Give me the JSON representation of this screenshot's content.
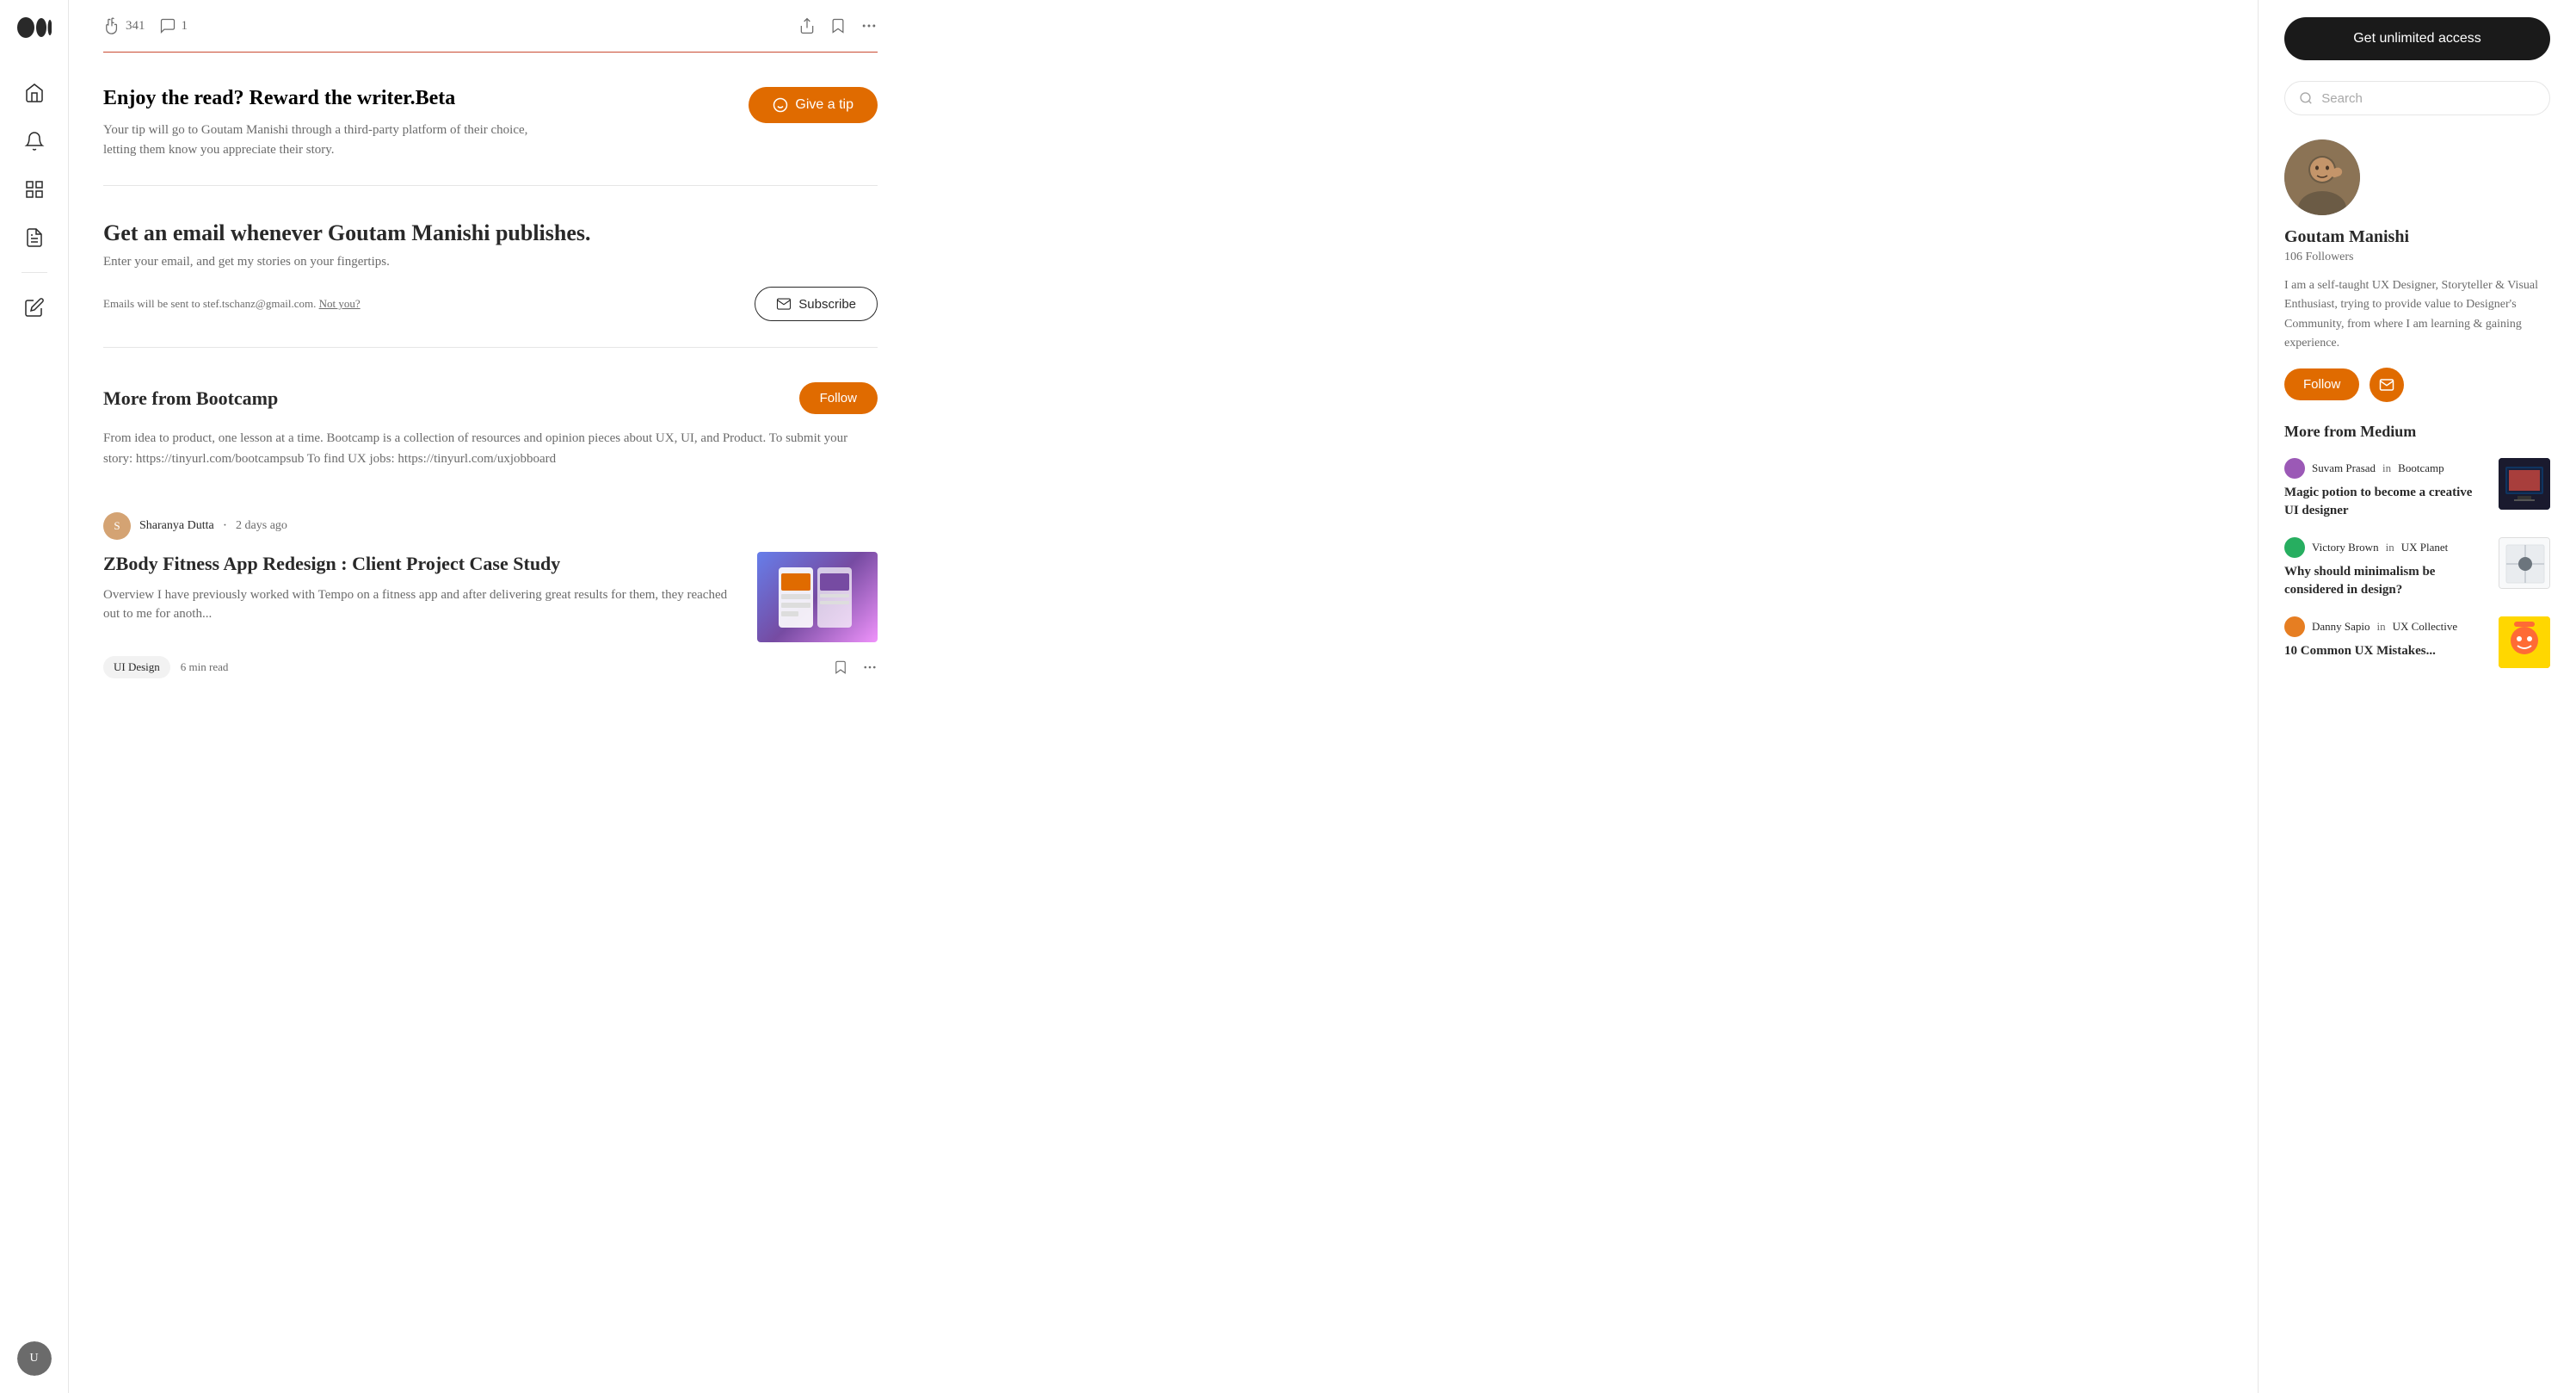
{
  "sidebar": {
    "logo_label": "Medium logo",
    "nav_items": [
      {
        "name": "home",
        "label": "Home"
      },
      {
        "name": "notifications",
        "label": "Notifications"
      },
      {
        "name": "lists",
        "label": "Lists"
      },
      {
        "name": "stories",
        "label": "Stories"
      }
    ],
    "write_label": "Write"
  },
  "article": {
    "reactions": {
      "claps": "341",
      "comments": "1"
    },
    "tip": {
      "title": "Enjoy the read? Reward the writer.",
      "beta_label": "Beta",
      "subtitle": "Your tip will go to Goutam Manishi through a third-party platform of their choice, letting them know you appreciate their story.",
      "button_label": "Give a tip"
    },
    "subscribe": {
      "title": "Get an email whenever Goutam Manishi publishes.",
      "subtitle": "Enter your email, and get my stories on your fingertips.",
      "email_info": "Emails will be sent to stef.tschanz@gmail.com.",
      "not_you_label": "Not you?",
      "button_label": "Subscribe"
    },
    "bootcamp": {
      "title": "More from Bootcamp",
      "follow_label": "Follow",
      "description": "From idea to product, one lesson at a time. Bootcamp is a collection of resources and opinion pieces about UX, UI, and Product. To submit your story: https://tinyurl.com/bootcampsub To find UX jobs: https://tinyurl.com/uxjobboard"
    },
    "featured_article": {
      "author": "Sharanya Dutta",
      "date": "2 days ago",
      "title": "ZBody Fitness App Redesign : Client Project Case Study",
      "excerpt": "Overview I have previously worked with Tempo on a fitness app and after delivering great results for them, they reached out to me for anoth...",
      "tag": "UI Design",
      "read_time": "6 min read"
    }
  },
  "right_sidebar": {
    "unlimited_btn": "Get unlimited access",
    "search": {
      "placeholder": "Search"
    },
    "author": {
      "name": "Goutam Manishi",
      "followers": "106 Followers",
      "bio": "I am a self-taught UX Designer, Storyteller & Visual Enthusiast, trying to provide value to Designer's Community, from where I am learning & gaining experience.",
      "follow_label": "Follow"
    },
    "more_from_medium_title": "More from Medium",
    "medium_articles": [
      {
        "author_name": "Suvam Prasad",
        "publication": "Bootcamp",
        "title": "Magic potion to become a creative UI designer",
        "thumb_type": "tv"
      },
      {
        "author_name": "Victory Brown",
        "publication": "UX Planet",
        "title": "Why should minimalism be considered in design?",
        "thumb_type": "design"
      },
      {
        "author_name": "Danny Sapio",
        "publication": "UX Collective",
        "title": "10 Common UX Mistakes...",
        "thumb_type": "cartoon"
      }
    ]
  }
}
